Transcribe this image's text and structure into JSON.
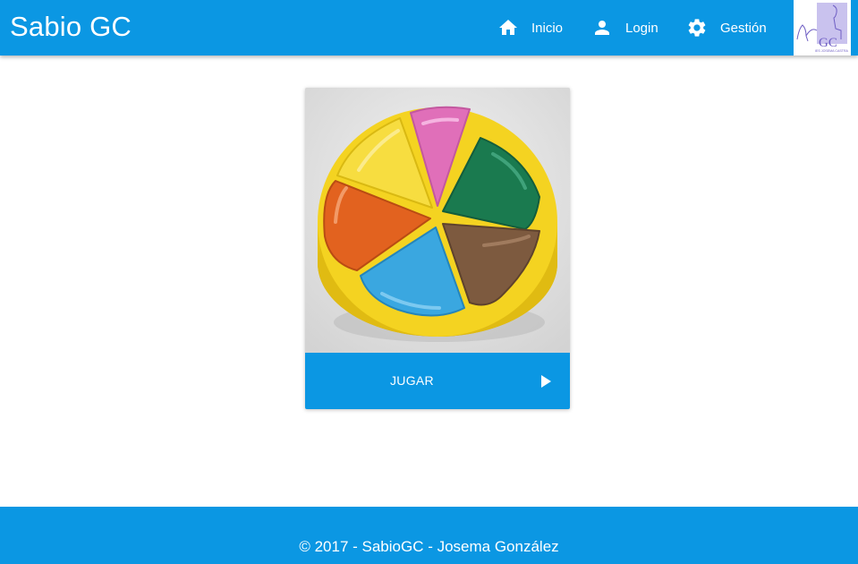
{
  "app": {
    "title": "Sabio GC"
  },
  "nav": {
    "items": [
      {
        "label": "Inicio",
        "icon": "home-icon"
      },
      {
        "label": "Login",
        "icon": "person-icon"
      },
      {
        "label": "Gestión",
        "icon": "gear-icon"
      }
    ],
    "logo": {
      "letters": "GC",
      "caption": "IES JOSEMA CASTRA"
    }
  },
  "card": {
    "image": "trivial-pie-game-piece",
    "action_label": "JUGAR",
    "action_icon": "play-arrow-icon"
  },
  "footer": {
    "text": "© 2017 - SabioGC - Josema González"
  },
  "colors": {
    "primary": "#0b97e3",
    "on_primary": "#ffffff",
    "pie_yellow": "#f4d321",
    "pie_pink": "#e06fb9",
    "pie_green": "#1a7a4f",
    "pie_brown": "#7d5a3f",
    "pie_blue": "#3aa7e0",
    "pie_orange": "#e2621f"
  }
}
